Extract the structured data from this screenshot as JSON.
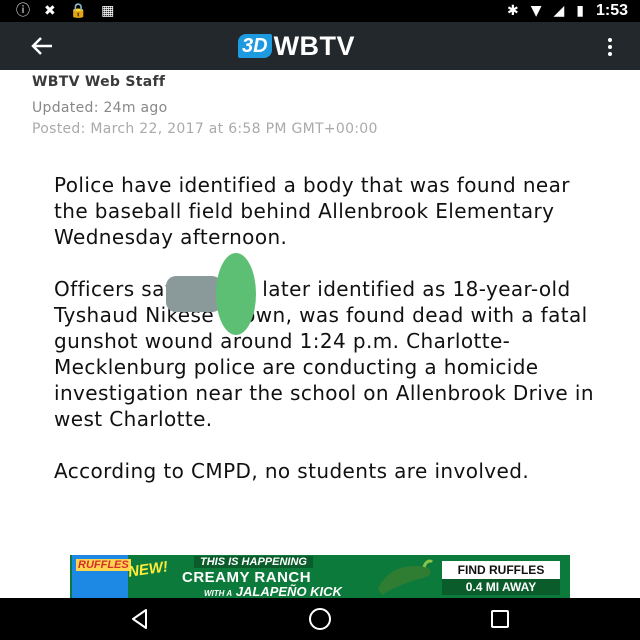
{
  "status_bar": {
    "time": "1:53",
    "icons": [
      "alert-circle-icon",
      "no-wifi-icon",
      "lock-icon",
      "android-icon",
      "bluetooth-icon",
      "wifi-icon",
      "no-signal-icon",
      "battery-charging-icon"
    ]
  },
  "app_bar": {
    "logo_badge": "3D",
    "logo_text": "WBTV",
    "back_icon": "arrow-back-icon",
    "menu_icon": "more-vert-icon"
  },
  "byline": {
    "author": "WBTV Web Staff",
    "updated": "Updated: 24m ago",
    "posted": "Posted: March 22, 2017 at 6:58 PM GMT+00:00"
  },
  "article": {
    "paragraphs": [
      "Police have identified a body that was found near the baseball field behind Allenbrook Elementary Wednesday afternoon.",
      "Officers say a man, later identified as 18-year-old Tyshaud Nikese Brown, was found dead with a fatal gunshot wound around 1:24 p.m. Charlotte-Mecklenburg police are conducting a homicide investigation near the school on Allenbrook Drive in west Charlotte.",
      "According to CMPD, no students are involved."
    ]
  },
  "ad": {
    "brand": "RUFFLES",
    "badge": "NEW!",
    "tagline": "THIS IS HAPPENING",
    "headline": "CREAMY RANCH",
    "subline_with": "WITH A",
    "subline": "JALAPEÑO KICK",
    "cta": "FIND RUFFLES",
    "distance": "0.4 MI AWAY"
  },
  "nav_bar": {
    "back": "nav-back-icon",
    "home": "nav-home-icon",
    "recents": "nav-recents-icon"
  },
  "colors": {
    "status_bar": "#000000",
    "app_bar": "#22282b",
    "logo_blue": "#1e9be0",
    "ad_green": "#0c7a3a",
    "handle_green": "#5dbf74",
    "handle_gray": "#8a9a9a"
  }
}
